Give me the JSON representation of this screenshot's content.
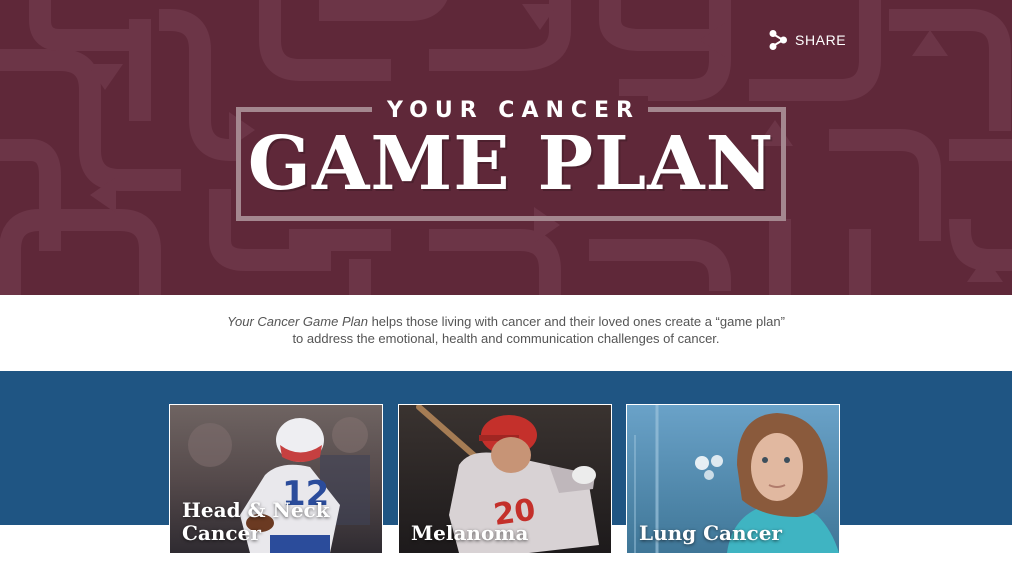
{
  "colors": {
    "hero_bg": "#5f2839",
    "band_bg": "#1f5583",
    "frame": "#a4878f",
    "text_body": "#555555"
  },
  "header": {
    "share_icon": "share-icon",
    "share_label": "SHARE"
  },
  "logo": {
    "top_line": "YOUR CANCER",
    "main_line": "GAME PLAN"
  },
  "intro": {
    "italic_title": "Your Cancer Game Plan",
    "line1_rest": " helps those living with cancer and their loved ones create a “game plan”",
    "line2": "to address the emotional, health and communication challenges of cancer."
  },
  "cards": [
    {
      "title": "Head & Neck Cancer"
    },
    {
      "title": "Melanoma"
    },
    {
      "title": "Lung Cancer"
    }
  ]
}
